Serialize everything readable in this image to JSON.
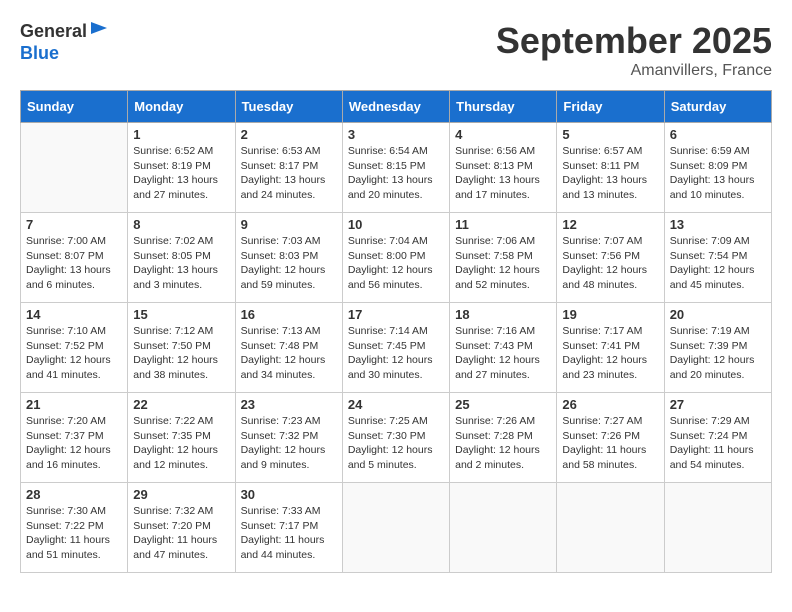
{
  "header": {
    "logo_general": "General",
    "logo_blue": "Blue",
    "month_title": "September 2025",
    "location": "Amanvillers, France"
  },
  "weekdays": [
    "Sunday",
    "Monday",
    "Tuesday",
    "Wednesday",
    "Thursday",
    "Friday",
    "Saturday"
  ],
  "weeks": [
    [
      {
        "day": "",
        "info": ""
      },
      {
        "day": "1",
        "info": "Sunrise: 6:52 AM\nSunset: 8:19 PM\nDaylight: 13 hours\nand 27 minutes."
      },
      {
        "day": "2",
        "info": "Sunrise: 6:53 AM\nSunset: 8:17 PM\nDaylight: 13 hours\nand 24 minutes."
      },
      {
        "day": "3",
        "info": "Sunrise: 6:54 AM\nSunset: 8:15 PM\nDaylight: 13 hours\nand 20 minutes."
      },
      {
        "day": "4",
        "info": "Sunrise: 6:56 AM\nSunset: 8:13 PM\nDaylight: 13 hours\nand 17 minutes."
      },
      {
        "day": "5",
        "info": "Sunrise: 6:57 AM\nSunset: 8:11 PM\nDaylight: 13 hours\nand 13 minutes."
      },
      {
        "day": "6",
        "info": "Sunrise: 6:59 AM\nSunset: 8:09 PM\nDaylight: 13 hours\nand 10 minutes."
      }
    ],
    [
      {
        "day": "7",
        "info": "Sunrise: 7:00 AM\nSunset: 8:07 PM\nDaylight: 13 hours\nand 6 minutes."
      },
      {
        "day": "8",
        "info": "Sunrise: 7:02 AM\nSunset: 8:05 PM\nDaylight: 13 hours\nand 3 minutes."
      },
      {
        "day": "9",
        "info": "Sunrise: 7:03 AM\nSunset: 8:03 PM\nDaylight: 12 hours\nand 59 minutes."
      },
      {
        "day": "10",
        "info": "Sunrise: 7:04 AM\nSunset: 8:00 PM\nDaylight: 12 hours\nand 56 minutes."
      },
      {
        "day": "11",
        "info": "Sunrise: 7:06 AM\nSunset: 7:58 PM\nDaylight: 12 hours\nand 52 minutes."
      },
      {
        "day": "12",
        "info": "Sunrise: 7:07 AM\nSunset: 7:56 PM\nDaylight: 12 hours\nand 48 minutes."
      },
      {
        "day": "13",
        "info": "Sunrise: 7:09 AM\nSunset: 7:54 PM\nDaylight: 12 hours\nand 45 minutes."
      }
    ],
    [
      {
        "day": "14",
        "info": "Sunrise: 7:10 AM\nSunset: 7:52 PM\nDaylight: 12 hours\nand 41 minutes."
      },
      {
        "day": "15",
        "info": "Sunrise: 7:12 AM\nSunset: 7:50 PM\nDaylight: 12 hours\nand 38 minutes."
      },
      {
        "day": "16",
        "info": "Sunrise: 7:13 AM\nSunset: 7:48 PM\nDaylight: 12 hours\nand 34 minutes."
      },
      {
        "day": "17",
        "info": "Sunrise: 7:14 AM\nSunset: 7:45 PM\nDaylight: 12 hours\nand 30 minutes."
      },
      {
        "day": "18",
        "info": "Sunrise: 7:16 AM\nSunset: 7:43 PM\nDaylight: 12 hours\nand 27 minutes."
      },
      {
        "day": "19",
        "info": "Sunrise: 7:17 AM\nSunset: 7:41 PM\nDaylight: 12 hours\nand 23 minutes."
      },
      {
        "day": "20",
        "info": "Sunrise: 7:19 AM\nSunset: 7:39 PM\nDaylight: 12 hours\nand 20 minutes."
      }
    ],
    [
      {
        "day": "21",
        "info": "Sunrise: 7:20 AM\nSunset: 7:37 PM\nDaylight: 12 hours\nand 16 minutes."
      },
      {
        "day": "22",
        "info": "Sunrise: 7:22 AM\nSunset: 7:35 PM\nDaylight: 12 hours\nand 12 minutes."
      },
      {
        "day": "23",
        "info": "Sunrise: 7:23 AM\nSunset: 7:32 PM\nDaylight: 12 hours\nand 9 minutes."
      },
      {
        "day": "24",
        "info": "Sunrise: 7:25 AM\nSunset: 7:30 PM\nDaylight: 12 hours\nand 5 minutes."
      },
      {
        "day": "25",
        "info": "Sunrise: 7:26 AM\nSunset: 7:28 PM\nDaylight: 12 hours\nand 2 minutes."
      },
      {
        "day": "26",
        "info": "Sunrise: 7:27 AM\nSunset: 7:26 PM\nDaylight: 11 hours\nand 58 minutes."
      },
      {
        "day": "27",
        "info": "Sunrise: 7:29 AM\nSunset: 7:24 PM\nDaylight: 11 hours\nand 54 minutes."
      }
    ],
    [
      {
        "day": "28",
        "info": "Sunrise: 7:30 AM\nSunset: 7:22 PM\nDaylight: 11 hours\nand 51 minutes."
      },
      {
        "day": "29",
        "info": "Sunrise: 7:32 AM\nSunset: 7:20 PM\nDaylight: 11 hours\nand 47 minutes."
      },
      {
        "day": "30",
        "info": "Sunrise: 7:33 AM\nSunset: 7:17 PM\nDaylight: 11 hours\nand 44 minutes."
      },
      {
        "day": "",
        "info": ""
      },
      {
        "day": "",
        "info": ""
      },
      {
        "day": "",
        "info": ""
      },
      {
        "day": "",
        "info": ""
      }
    ]
  ]
}
